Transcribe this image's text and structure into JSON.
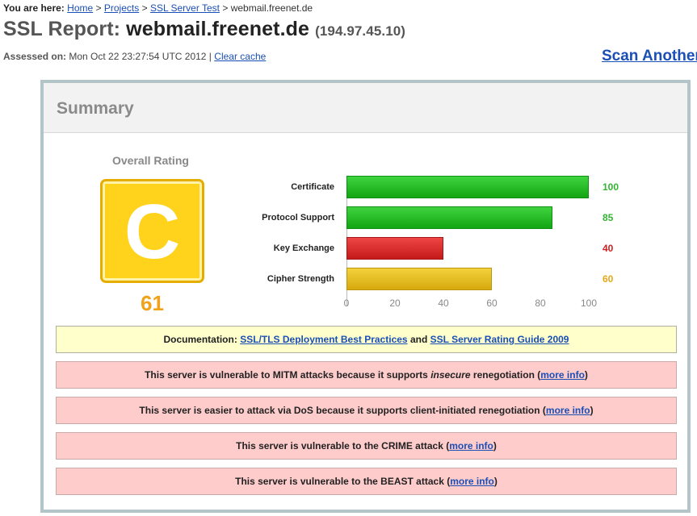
{
  "breadcrumb": {
    "prefix": "You are here:",
    "items": [
      "Home",
      "Projects",
      "SSL Server Test"
    ],
    "separator": ">",
    "current": "webmail.freenet.de"
  },
  "report": {
    "title_prefix": "SSL Report:",
    "host": "webmail.freenet.de",
    "ip": "(194.97.45.10)",
    "assessed_label": "Assessed on:",
    "assessed_value": "Mon Oct 22 23:27:54 UTC 2012 |",
    "clear_cache": "Clear cache",
    "scan_another": "Scan Another"
  },
  "summary": {
    "title": "Summary",
    "overall_label": "Overall Rating",
    "grade": "C",
    "score": "61",
    "grade_color": "#ffd21c",
    "score_color": "#f0a21b"
  },
  "chart_data": {
    "type": "bar",
    "orientation": "horizontal",
    "categories": [
      "Certificate",
      "Protocol Support",
      "Key Exchange",
      "Cipher Strength"
    ],
    "values": [
      100,
      85,
      40,
      60
    ],
    "value_labels": [
      "100",
      "85",
      "40",
      "60"
    ],
    "bar_colors": [
      "#1fbf1f",
      "#1fbf1f",
      "#dd2d2d",
      "#e7bd1f"
    ],
    "value_colors": [
      "#33b533",
      "#33b533",
      "#cc2222",
      "#e6a817"
    ],
    "xlim": [
      0,
      100
    ],
    "xticks": [
      "0",
      "20",
      "40",
      "60",
      "80",
      "100"
    ],
    "grid": false
  },
  "documentation": {
    "prefix": "Documentation:",
    "link1": "SSL/TLS Deployment Best Practices",
    "and": "and",
    "link2": "SSL Server Rating Guide 2009"
  },
  "warnings": [
    {
      "pre": "This server is vulnerable to MITM attacks because it supports ",
      "em": "insecure",
      "post": " renegotiation (",
      "link": "more info",
      "close": ")"
    },
    {
      "pre": "This server is easier to attack via DoS because it supports client-initiated renegotiation (",
      "em": "",
      "post": "",
      "link": "more info",
      "close": ")"
    },
    {
      "pre": "This server is vulnerable to the CRIME attack (",
      "em": "",
      "post": "",
      "link": "more info",
      "close": ")"
    },
    {
      "pre": "This server is vulnerable to the BEAST attack (",
      "em": "",
      "post": "",
      "link": "more info",
      "close": ")"
    }
  ]
}
